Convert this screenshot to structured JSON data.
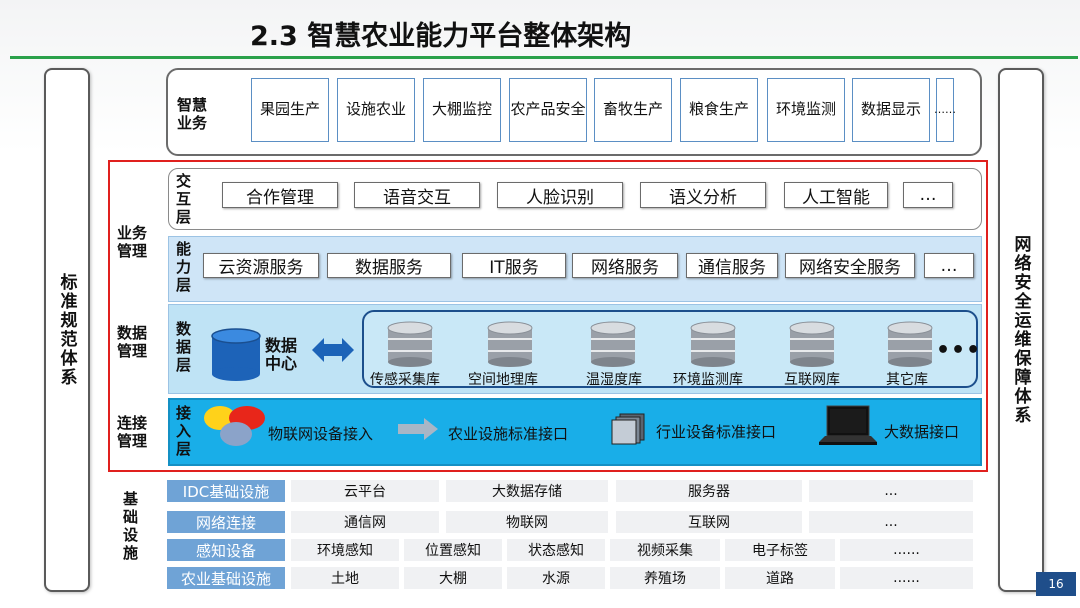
{
  "title": "2.3 智慧农业能力平台整体架构",
  "left_side": "标准规范体系",
  "right_side": "网络安全运维保障体系",
  "smart_business": {
    "label": "智慧业务",
    "items": [
      "果园生产",
      "设施农业",
      "大棚监控",
      "农产品安全",
      "畜牧生产",
      "粮食生产",
      "环境监测",
      "数据显示",
      "……"
    ]
  },
  "group_labels": {
    "business": "业务管理",
    "data": "数据管理",
    "connect": "连接管理",
    "infra": "基础设施"
  },
  "interaction": {
    "label": "交互层",
    "items": [
      "合作管理",
      "语音交互",
      "人脸识别",
      "语义分析",
      "人工智能",
      "…"
    ]
  },
  "capability": {
    "label": "能力层",
    "items": [
      "云资源服务",
      "数据服务",
      "IT服务",
      "网络服务",
      "通信服务",
      "网络安全服务",
      "…"
    ]
  },
  "data_layer": {
    "label": "数据层",
    "center": "数据中心",
    "dbs": [
      "传感采集库",
      "空间地理库",
      "温湿度库",
      "环境监测库",
      "互联网库",
      "其它库"
    ],
    "more": "•••"
  },
  "access_layer": {
    "label": "接入层",
    "items": [
      "物联网设备接入",
      "农业设施标准接口",
      "行业设备标准接口",
      "大数据接口"
    ]
  },
  "infrastructure": [
    {
      "header": "IDC基础设施",
      "cells": [
        "云平台",
        "大数据存储",
        "服务器",
        "..."
      ]
    },
    {
      "header": "网络连接",
      "cells": [
        "通信网",
        "物联网",
        "互联网",
        "..."
      ]
    },
    {
      "header": "感知设备",
      "cells": [
        "环境感知",
        "位置感知",
        "状态感知",
        "视频采集",
        "电子标签",
        "......"
      ]
    },
    {
      "header": "农业基础设施",
      "cells": [
        "土地",
        "大棚",
        "水源",
        "养殖场",
        "道路",
        "......"
      ]
    }
  ],
  "page_number": "16",
  "colors": {
    "accent_green": "#2aa14a",
    "frame_red": "#e0201e",
    "access_blue": "#19aee8",
    "infra_header": "#6fa3d6"
  }
}
